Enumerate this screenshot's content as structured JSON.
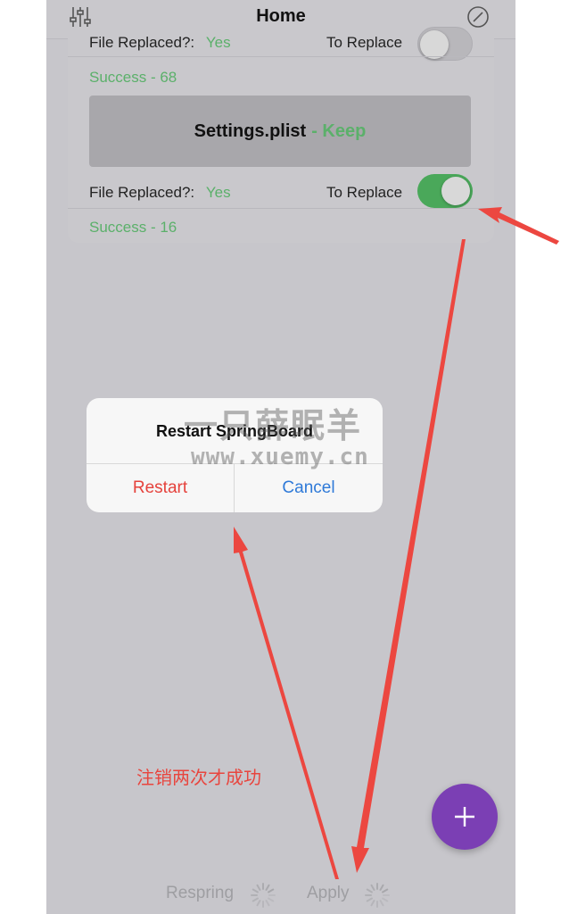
{
  "nav": {
    "title": "Home",
    "left_icon": "sliders-icon",
    "right_icon": "compass-icon"
  },
  "files": [
    {
      "replaced_label": "File Replaced?:",
      "replaced_value": "Yes",
      "toggle_label": "To Replace",
      "toggle_on": false,
      "success": "Success - 68"
    },
    {
      "name": "Settings.plist",
      "status": "- Keep",
      "replaced_label": "File Replaced?:",
      "replaced_value": "Yes",
      "toggle_label": "To Replace",
      "toggle_on": true,
      "success": "Success - 16"
    }
  ],
  "alert": {
    "title": "Restart SpringBoard",
    "restart_label": "Restart",
    "cancel_label": "Cancel"
  },
  "watermark": {
    "line1": "一只薛眠羊",
    "line2": "www.xuemy.cn"
  },
  "annotation": {
    "text": "注销两次才成功"
  },
  "bottom_bar": {
    "respring_label": "Respring",
    "apply_label": "Apply"
  },
  "colors": {
    "success": "#5bb06a",
    "destructive": "#e5423c",
    "link": "#2f7ad8",
    "fab": "#7b3fb4",
    "annotation": "#e8453e"
  }
}
